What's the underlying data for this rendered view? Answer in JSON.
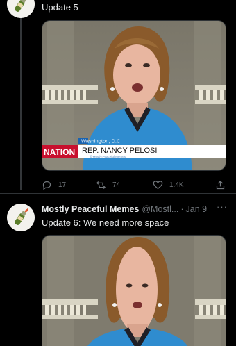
{
  "thread": {
    "first_tweet": {
      "text": "Update 5",
      "media": {
        "chyron_location": "Washington, D.C.",
        "chyron_name": "REP. NANCY PELOSI",
        "chyron_sub": "@Mostly.Peaceful.Memes",
        "network_logo": "NATION"
      },
      "actions": {
        "reply_count": "17",
        "retweet_count": "74",
        "like_count": "1.4K"
      }
    },
    "second_tweet": {
      "display_name": "Mostly Peaceful Memes",
      "handle": "@Mostl...",
      "separator": "·",
      "date": "Jan 9",
      "text": "Update 6: We need more space"
    }
  },
  "icons": {
    "avatar": "molotov-cocktail-avatar-icon",
    "reply": "reply-icon",
    "retweet": "retweet-icon",
    "like": "heart-icon",
    "share": "share-icon",
    "more": "more-options-icon"
  },
  "colors": {
    "background": "#000000",
    "text_primary": "#e7e9ea",
    "text_secondary": "#71767b",
    "chyron_red": "#c8102e",
    "jacket_blue": "#2f8ccf"
  }
}
